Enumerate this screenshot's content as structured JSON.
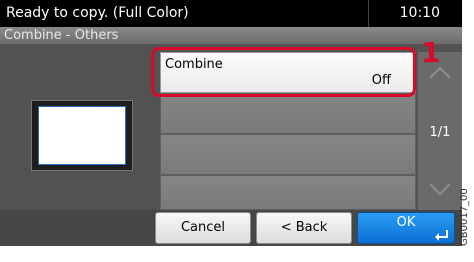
{
  "status": {
    "message": "Ready to copy. (Full Color)",
    "time": "10:10"
  },
  "title": "Combine - Others",
  "list": {
    "items": [
      {
        "label": "Combine",
        "value": "Off"
      }
    ]
  },
  "callout": "1",
  "pagination": {
    "text": "1/1"
  },
  "buttons": {
    "cancel": "Cancel",
    "back": "< Back",
    "ok": "OK"
  },
  "figure_code": "GB0017_00",
  "colors": {
    "highlight": "#d70a28",
    "ok_button": "#1583e4",
    "status_bar": "#000000"
  }
}
